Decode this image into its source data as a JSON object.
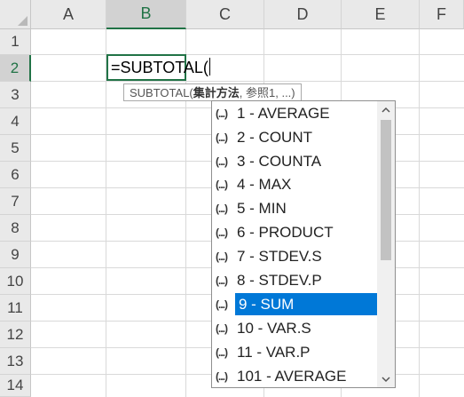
{
  "columns": [
    "A",
    "B",
    "C",
    "D",
    "E",
    "F"
  ],
  "rows": [
    "1",
    "2",
    "3",
    "4",
    "5",
    "6",
    "7",
    "8",
    "9",
    "10",
    "11",
    "12",
    "13",
    "14"
  ],
  "active_cell": {
    "formula": "=SUBTOTAL("
  },
  "tooltip": {
    "prefix": "SUBTOTAL(",
    "bold_arg": "集計方法",
    "rest": ", 参照1, ...)"
  },
  "autocomplete": {
    "icon_text": "(...)",
    "items": [
      "1 - AVERAGE",
      "2 - COUNT",
      "3 - COUNTA",
      "4 - MAX",
      "5 - MIN",
      "6 - PRODUCT",
      "7 - STDEV.S",
      "8 - STDEV.P",
      "9 - SUM",
      "10 - VAR.S",
      "11 - VAR.P",
      "101 - AVERAGE"
    ],
    "selected_index": 8
  },
  "colors": {
    "accent_green": "#217346",
    "selection_blue": "#0078d7"
  }
}
